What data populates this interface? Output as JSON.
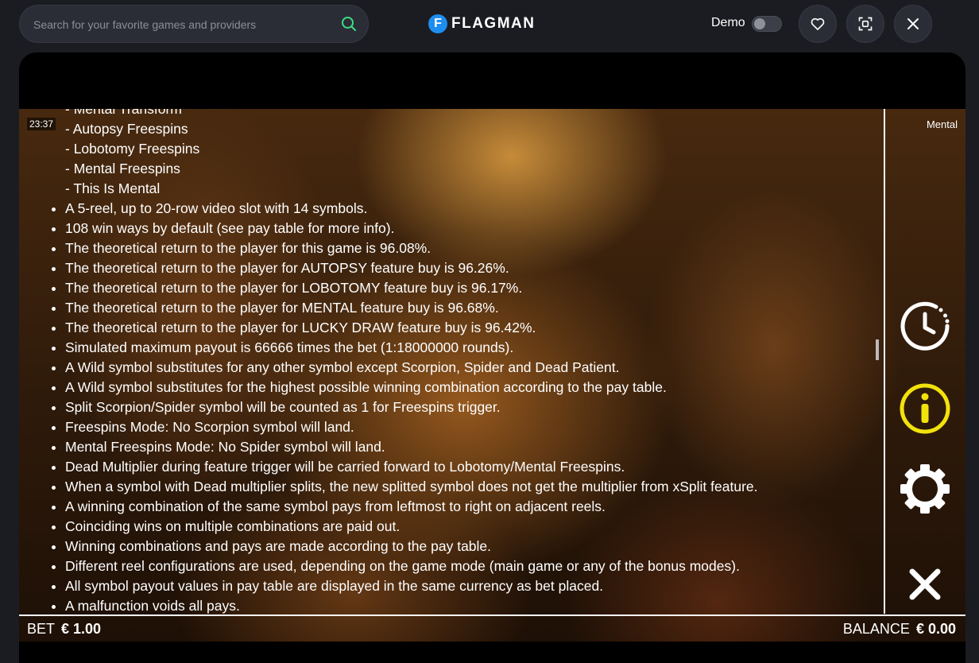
{
  "header": {
    "search_placeholder": "Search for your favorite games and providers",
    "logo_letter": "F",
    "logo_text": "FLAGMAN",
    "demo_label": "Demo"
  },
  "game": {
    "clock": "23:37",
    "mode_label": "Mental",
    "feature_list": [
      "Mental Transform",
      "Autopsy Freespins",
      "Lobotomy Freespins",
      "Mental Freespins",
      "This Is Mental"
    ],
    "rules": [
      "A 5-reel, up to 20-row video slot with 14 symbols.",
      "108 win ways by default (see pay table for more info).",
      "The theoretical return to the player for this game is 96.08%.",
      "The theoretical return to the player for AUTOPSY feature buy is 96.26%.",
      "The theoretical return to the player for LOBOTOMY feature buy is 96.17%.",
      "The theoretical return to the player for MENTAL feature buy is 96.68%.",
      "The theoretical return to the player for LUCKY DRAW feature buy is 96.42%.",
      "Simulated maximum payout is 66666 times the bet (1:18000000 rounds).",
      "A Wild symbol substitutes for any other symbol except Scorpion, Spider and Dead Patient.",
      "A Wild symbol substitutes for the highest possible winning combination according to the pay table.",
      "Split Scorpion/Spider symbol will be counted as 1 for Freespins trigger.",
      "Freespins Mode: No Scorpion symbol will land.",
      "Mental Freespins Mode: No Spider symbol will land.",
      "Dead Multiplier during feature trigger will be carried forward to Lobotomy/Mental Freespins.",
      "When a symbol with Dead multiplier splits, the new splitted symbol does not get the multiplier from xSplit feature.",
      "A winning combination of the same symbol pays from leftmost to right on adjacent reels.",
      "Coinciding wins on multiple combinations are paid out.",
      "Winning combinations and pays are made according to the pay table.",
      "Different reel configurations are used, depending on the game mode (main game or any of the bonus modes).",
      "All symbol payout values in pay table are displayed in the same currency as bet placed.",
      "A malfunction voids all pays."
    ],
    "bet_label": "BET",
    "bet_value": "€ 1.00",
    "balance_label": "BALANCE",
    "balance_value": "€ 0.00"
  },
  "colors": {
    "accent_green": "#3ddc84",
    "info_yellow": "#f2e20c",
    "logo_blue": "#1e8df0"
  },
  "icons": [
    "search-icon",
    "heart-icon",
    "fullscreen-icon",
    "close-icon",
    "history-icon",
    "info-icon",
    "settings-icon",
    "close-rules-icon"
  ]
}
